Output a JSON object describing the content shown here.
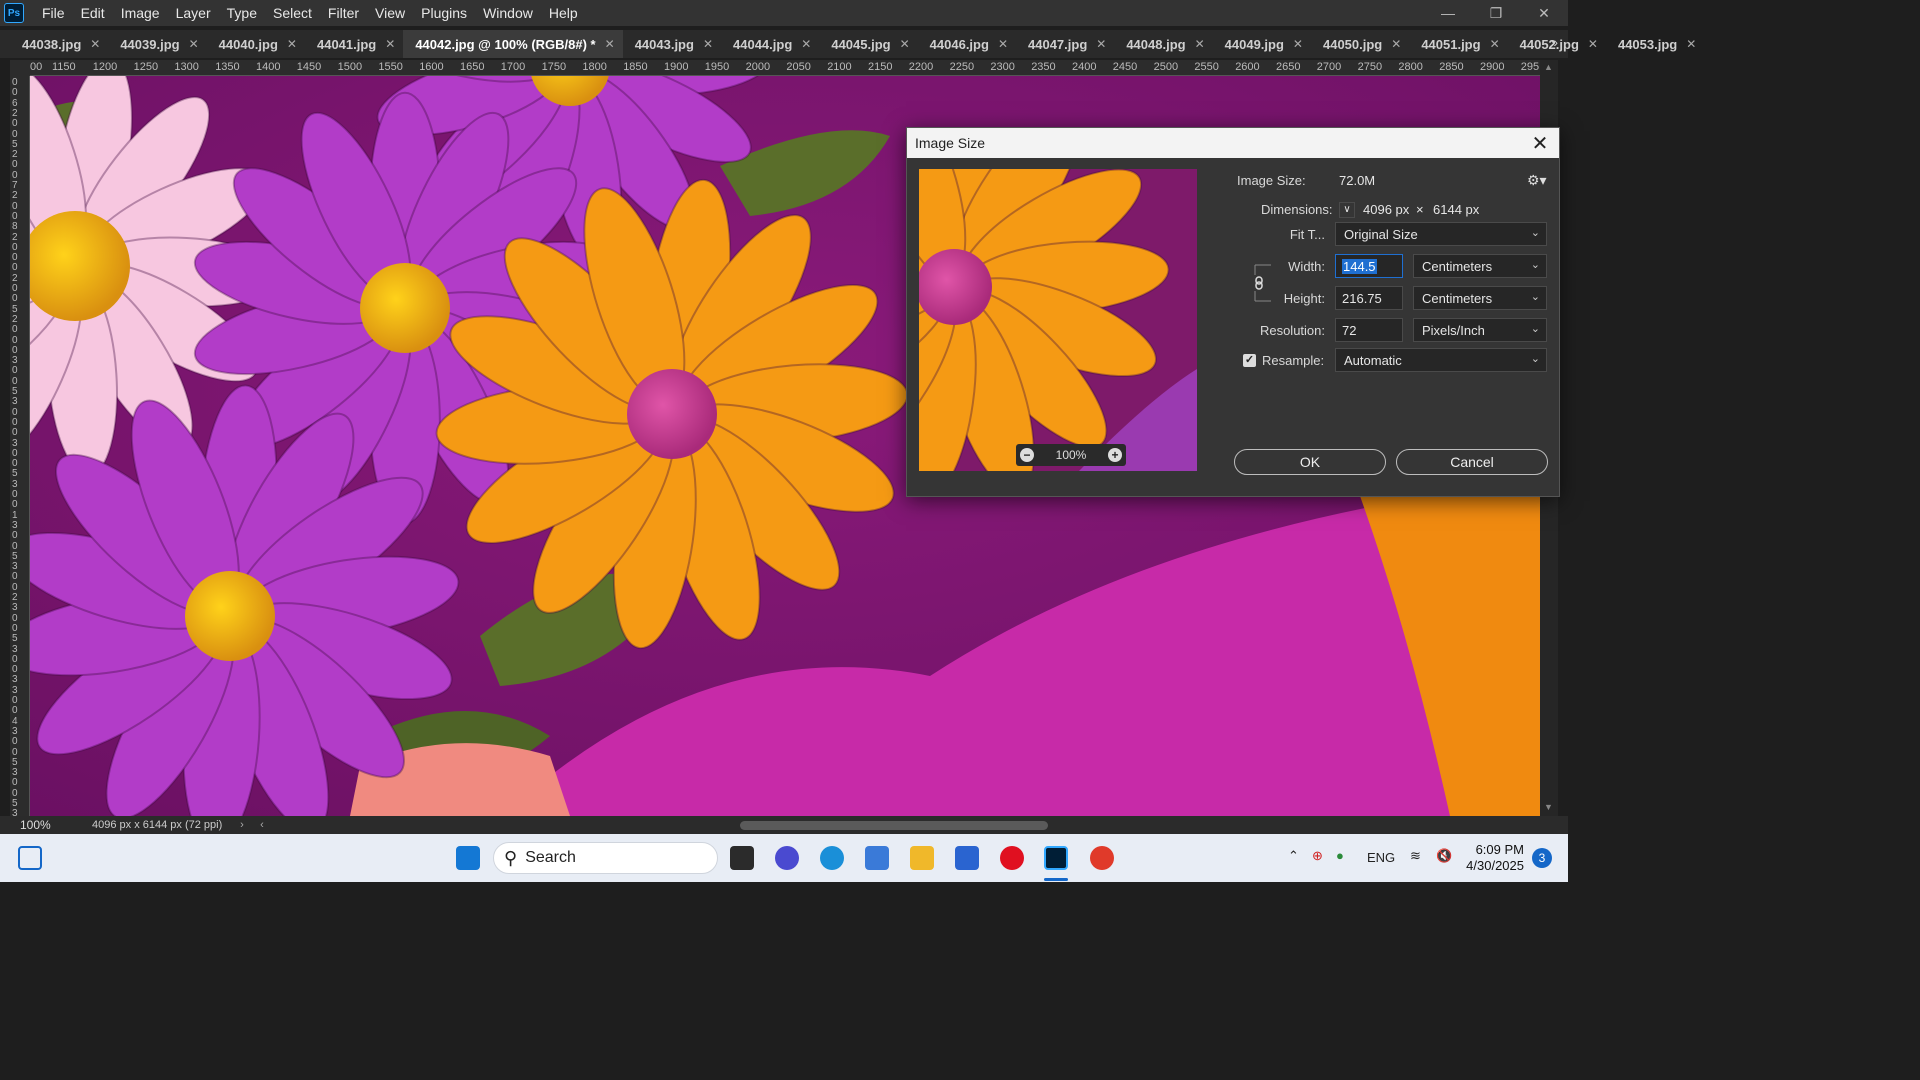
{
  "menu": [
    "File",
    "Edit",
    "Image",
    "Layer",
    "Type",
    "Select",
    "Filter",
    "View",
    "Plugins",
    "Window",
    "Help"
  ],
  "app_logo": "Ps",
  "tabs": [
    {
      "label": "44038.jpg",
      "active": false
    },
    {
      "label": "44039.jpg",
      "active": false
    },
    {
      "label": "44040.jpg",
      "active": false
    },
    {
      "label": "44041.jpg",
      "active": false
    },
    {
      "label": "44042.jpg @ 100% (RGB/8#) *",
      "active": true
    },
    {
      "label": "44043.jpg",
      "active": false
    },
    {
      "label": "44044.jpg",
      "active": false
    },
    {
      "label": "44045.jpg",
      "active": false
    },
    {
      "label": "44046.jpg",
      "active": false
    },
    {
      "label": "44047.jpg",
      "active": false
    },
    {
      "label": "44048.jpg",
      "active": false
    },
    {
      "label": "44049.jpg",
      "active": false
    },
    {
      "label": "44050.jpg",
      "active": false
    },
    {
      "label": "44051.jpg",
      "active": false
    },
    {
      "label": "44052.jpg",
      "active": false
    },
    {
      "label": "44053.jpg",
      "active": false
    }
  ],
  "ruler_h": [
    "00",
    "1150",
    "1200",
    "1250",
    "1300",
    "1350",
    "1400",
    "1450",
    "1500",
    "1550",
    "1600",
    "1650",
    "1700",
    "1750",
    "1800",
    "1850",
    "1900",
    "1950",
    "2000",
    "2050",
    "2100",
    "2150",
    "2200",
    "2250",
    "2300",
    "2350",
    "2400",
    "2450",
    "2500",
    "2550",
    "2600",
    "2650",
    "2700",
    "2750",
    "2800",
    "2850",
    "2900",
    "295"
  ],
  "ruler_v": [
    "0",
    "0",
    "6",
    "2",
    "0",
    "0",
    "5",
    "2",
    "0",
    "0",
    "7",
    "2",
    "0",
    "0",
    "8",
    "2",
    "0",
    "0",
    "0",
    "2",
    "0",
    "0",
    "5",
    "2",
    "0",
    "0",
    "0",
    "3",
    "0",
    "0",
    "5",
    "3",
    "0",
    "0",
    "0",
    "3",
    "0",
    "0",
    "5",
    "3",
    "0",
    "0",
    "1",
    "3",
    "0",
    "0",
    "5",
    "3",
    "0",
    "0",
    "2",
    "3",
    "0",
    "0",
    "5",
    "3",
    "0",
    "0",
    "3",
    "3",
    "0",
    "0",
    "4",
    "3",
    "0",
    "0",
    "5",
    "3",
    "0",
    "0",
    "5",
    "3"
  ],
  "status": {
    "zoom": "100%",
    "doc_info": "4096 px x 6144 px (72 ppi)"
  },
  "dialog": {
    "title": "Image Size",
    "image_size_label": "Image Size:",
    "image_size_value": "72.0M",
    "dimensions_label": "Dimensions:",
    "dim_width": "4096 px",
    "dim_x": "×",
    "dim_height": "6144 px",
    "fit_label": "Fit T...",
    "fit_value": "Original Size",
    "width_label": "Width:",
    "width_value": "144.5",
    "width_unit": "Centimeters",
    "height_label": "Height:",
    "height_value": "216.75",
    "height_unit": "Centimeters",
    "resolution_label": "Resolution:",
    "resolution_value": "72",
    "resolution_unit": "Pixels/Inch",
    "resample_label": "Resample:",
    "resample_checked": true,
    "resample_value": "Automatic",
    "preview_zoom": "100%",
    "ok_label": "OK",
    "cancel_label": "Cancel"
  },
  "taskbar": {
    "search_label": "Search",
    "lang": "ENG",
    "time": "6:09 PM",
    "date": "4/30/2025",
    "notification_count": "3"
  },
  "colors": {
    "canvas_bg": "#9b1a86",
    "purple_flower": "#b23cc8",
    "orange_flower": "#f59a14",
    "pink_flower": "#f7c7e0",
    "flower_center": "#e6b214",
    "accent_blue": "#1f6fd1"
  }
}
